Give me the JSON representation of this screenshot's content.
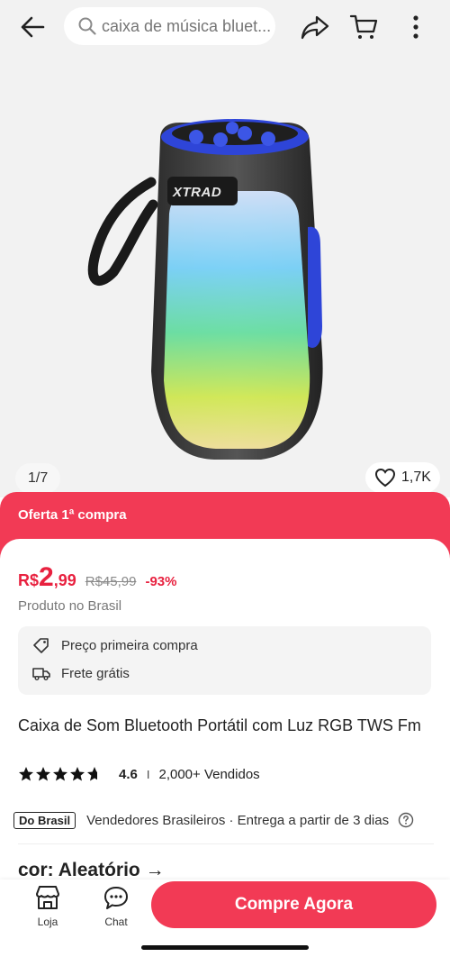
{
  "search": {
    "placeholder": "caixa de música bluet..."
  },
  "gallery": {
    "counter": "1/7",
    "likes": "1,7K",
    "brand_logo": "XTRAD"
  },
  "offer": {
    "label": "Oferta 1ª compra"
  },
  "price": {
    "currency": "R$",
    "integer": "2",
    "decimal": ",99",
    "old_price": "R$45,99",
    "discount": "-93%"
  },
  "origin": "Produto no Brasil",
  "benefits": [
    {
      "icon": "tag-icon",
      "label": "Preço primeira compra"
    },
    {
      "icon": "truck-icon",
      "label": "Frete grátis"
    }
  ],
  "product": {
    "title": "Caixa de Som Bluetooth Portátil com Luz RGB TWS Fm",
    "rating": "4.6",
    "rating_separator": "I",
    "sold": "2,000+ Vendidos",
    "stars": 4.6
  },
  "seller": {
    "badge": "Do Brasil",
    "text": "Vendedores Brasileiros · Entrega a partir de 3 dias"
  },
  "variant": {
    "label": "cor: Aleatório →"
  },
  "bottom_nav": {
    "store_label": "Loja",
    "chat_label": "Chat",
    "buy_label": "Compre Agora"
  },
  "colors": {
    "accent": "#f23a55",
    "price": "#e8213f"
  }
}
